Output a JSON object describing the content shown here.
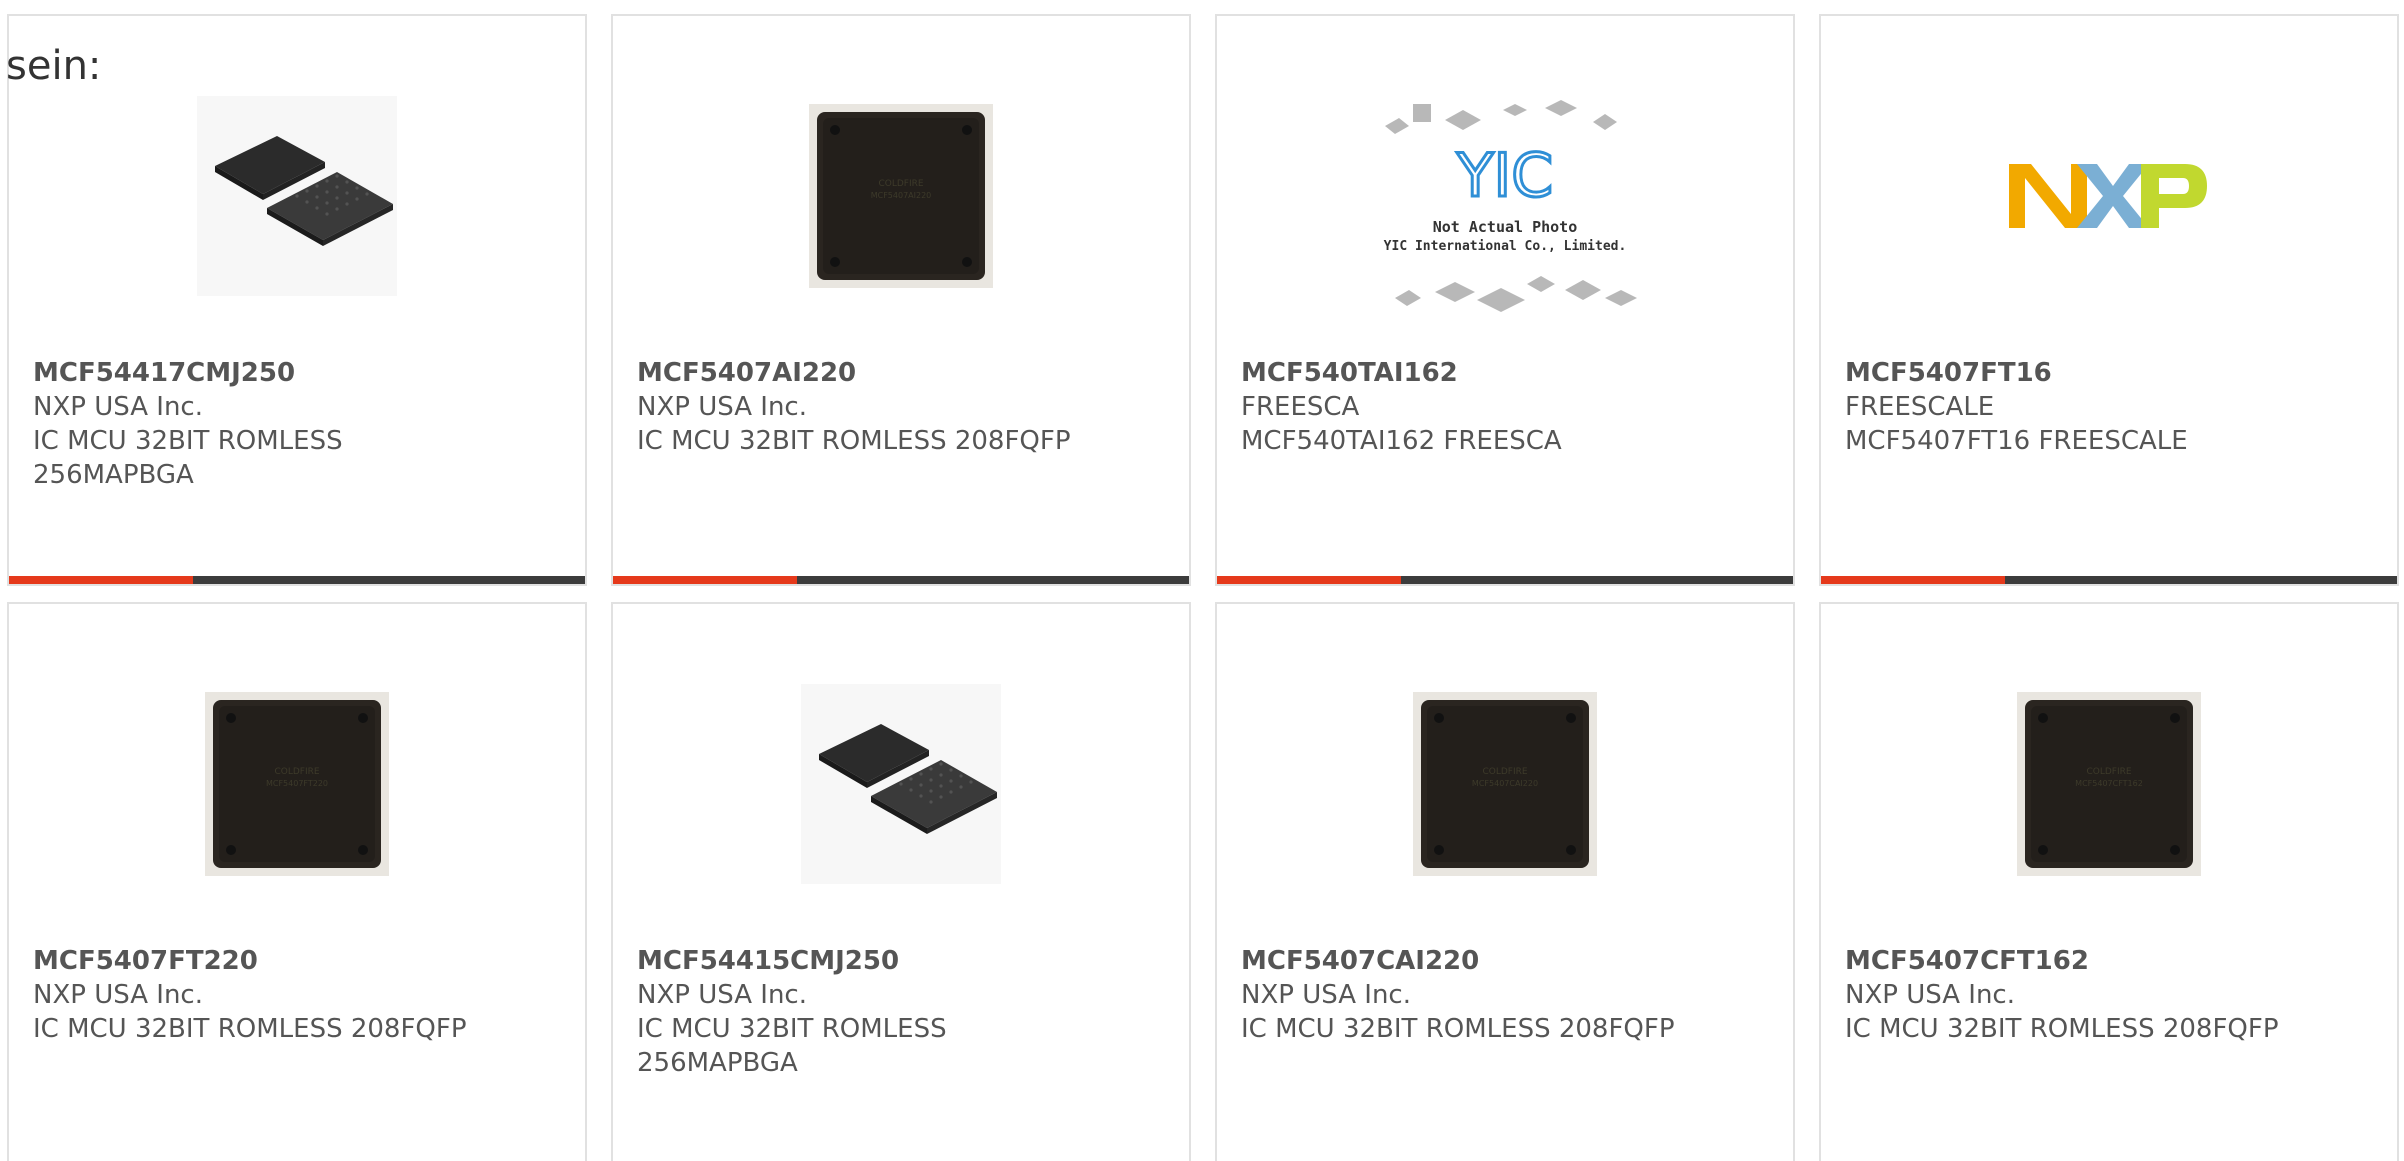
{
  "intro": {
    "text": "sein:"
  },
  "colors": {
    "accent": "#e5391b",
    "bar": "#3c3c3c",
    "border": "#e1e1e1",
    "text": "#555555"
  },
  "products": [
    {
      "part": "MCF54417CMJ250",
      "manufacturer": "NXP USA Inc.",
      "description": "IC MCU 32BIT ROMLESS 256MAPBGA",
      "image": "bga-package-icon"
    },
    {
      "part": "MCF5407AI220",
      "manufacturer": "NXP USA Inc.",
      "description": "IC MCU 32BIT ROMLESS 208FQFP",
      "image": "qfp-chip-icon"
    },
    {
      "part": "MCF540TAI162",
      "manufacturer": "FREESCA",
      "description": "MCF540TAI162 FREESCA",
      "image": "yic-placeholder-image",
      "image_caption": [
        "Not Actual Photo",
        "YIC International Co., Limited."
      ],
      "image_logo": "YIC"
    },
    {
      "part": "MCF5407FT16",
      "manufacturer": "FREESCALE",
      "description": "MCF5407FT16 FREESCALE",
      "image": "nxp-logo-image",
      "image_logo": "NXP"
    },
    {
      "part": "MCF5407FT220",
      "manufacturer": "NXP USA Inc.",
      "description": "IC MCU 32BIT ROMLESS 208FQFP",
      "image": "qfp-chip-icon"
    },
    {
      "part": "MCF54415CMJ250",
      "manufacturer": "NXP USA Inc.",
      "description": "IC MCU 32BIT ROMLESS 256MAPBGA",
      "image": "bga-package-icon"
    },
    {
      "part": "MCF5407CAI220",
      "manufacturer": "NXP USA Inc.",
      "description": "IC MCU 32BIT ROMLESS 208FQFP",
      "image": "qfp-chip-icon"
    },
    {
      "part": "MCF5407CFT162",
      "manufacturer": "NXP USA Inc.",
      "description": "IC MCU 32BIT ROMLESS 208FQFP",
      "image": "qfp-chip-icon"
    }
  ]
}
